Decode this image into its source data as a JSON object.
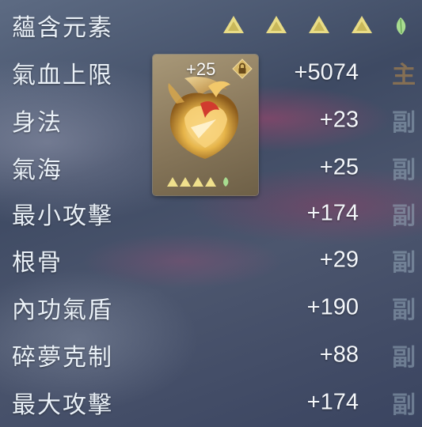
{
  "element_row": {
    "label": "蘊含元素",
    "triangles": [
      {
        "icon": "gold-triangle-icon"
      },
      {
        "icon": "gold-triangle-icon"
      },
      {
        "icon": "gold-triangle-icon"
      },
      {
        "icon": "gold-triangle-icon"
      }
    ],
    "leaf_icon": "green-leaf-icon"
  },
  "item": {
    "level": "+25",
    "lock_icon": "lock-icon",
    "art_icon": "golden-phoenix-item-icon",
    "mini_triangle_count": 4
  },
  "stats": [
    {
      "label": "氣血上限",
      "value": "+5074",
      "tag": "主"
    },
    {
      "label": "身法",
      "value": "+23",
      "tag": "副"
    },
    {
      "label": "氣海",
      "value": "+25",
      "tag": "副"
    },
    {
      "label": "最小攻擊",
      "value": "+174",
      "tag": "副"
    },
    {
      "label": "根骨",
      "value": "+29",
      "tag": "副"
    },
    {
      "label": "內功氣盾",
      "value": "+190",
      "tag": "副"
    },
    {
      "label": "碎夢克制",
      "value": "+88",
      "tag": "副"
    },
    {
      "label": "最大攻擊",
      "value": "+174",
      "tag": "副"
    }
  ],
  "colors": {
    "triangle": "#e8d880",
    "leaf": "#9fd48a",
    "main_tag": "#967850",
    "sub_tag": "#96aab9"
  }
}
